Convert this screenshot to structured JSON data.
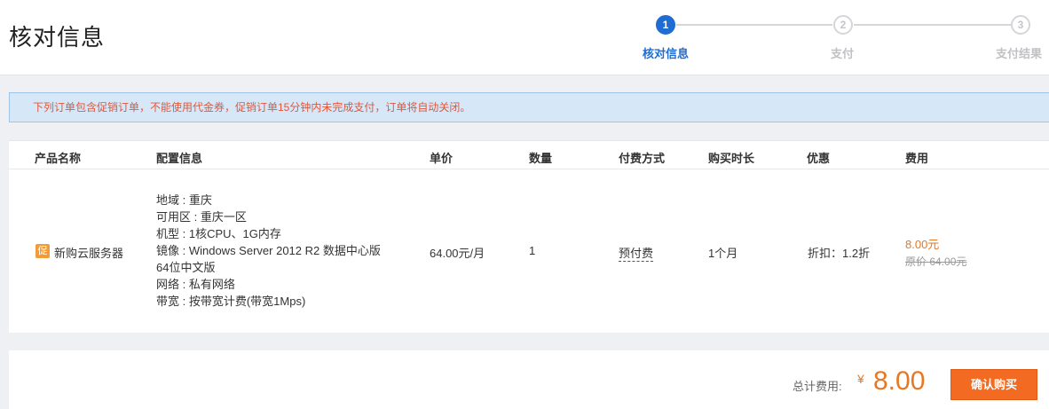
{
  "header": {
    "title": "核对信息",
    "steps": [
      {
        "number": "1",
        "label": "核对信息"
      },
      {
        "number": "2",
        "label": "支付"
      },
      {
        "number": "3",
        "label": "支付结果"
      }
    ]
  },
  "notice": {
    "text": "下列订单包含促销订单，不能使用代金券，促销订单15分钟内未完成支付，订单将自动关闭。"
  },
  "table": {
    "columns": [
      "产品名称",
      "配置信息",
      "单价",
      "数量",
      "付费方式",
      "购买时长",
      "优惠",
      "费用"
    ],
    "row": {
      "promo_badge": "促",
      "product_name": "新购云服务器",
      "config": [
        "地域 : 重庆",
        "可用区 : 重庆一区",
        "机型 : 1核CPU、1G内存",
        "镜像 : Windows Server 2012 R2 数据中心版",
        "64位中文版",
        "网络 : 私有网络",
        "带宽 : 按带宽计费(带宽1Mps)"
      ],
      "unit_price": "64.00元/月",
      "quantity": "1",
      "payment_method": "预付费",
      "duration": "1个月",
      "discount": "折扣：1.2折",
      "fee": "8.00元",
      "original_price": "原价 64.00元"
    }
  },
  "footer": {
    "total_label": "总计费用:",
    "currency_symbol": "¥",
    "total_amount": "8.00",
    "confirm_label": "确认购买"
  },
  "colors": {
    "accent_blue": "#1f6cd3",
    "price_orange": "#e87722",
    "button_orange": "#f36b22",
    "notice_text": "#e4553a"
  }
}
